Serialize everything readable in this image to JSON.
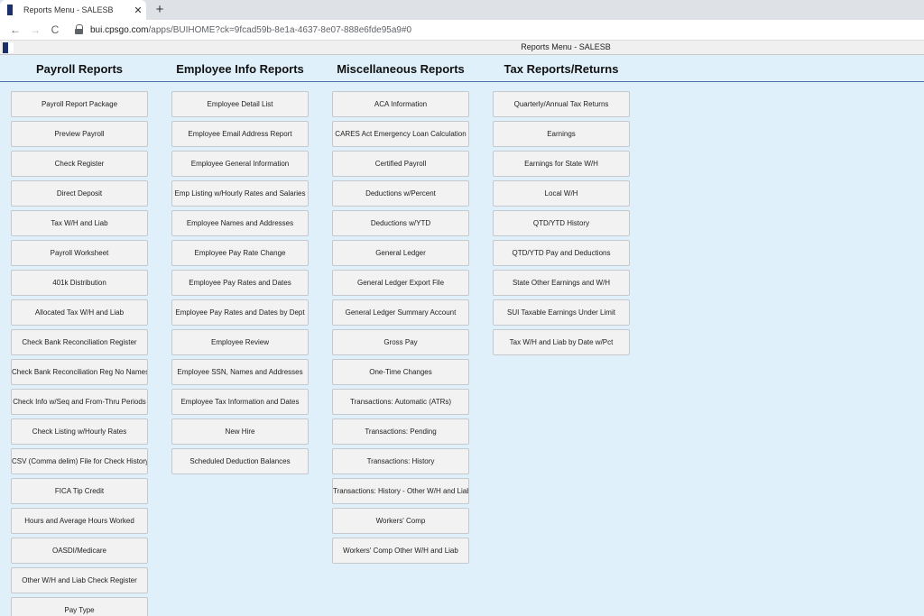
{
  "browser": {
    "tab_title": "Reports Menu - SALESB",
    "tab_close": "✕",
    "new_tab": "+",
    "url_host": "bui.cpsgo.com",
    "url_path": "/apps/BUIHOME?ck=9fcad59b-8e1a-4637-8e07-888e6fde95a9#0",
    "nav": {
      "back": "←",
      "forward": "→",
      "reload": "C"
    }
  },
  "app": {
    "title": "Reports Menu - SALESB"
  },
  "columns": [
    {
      "heading": "Payroll Reports",
      "items": [
        "Payroll Report Package",
        "Preview Payroll",
        "Check Register",
        "Direct Deposit",
        "Tax W/H and Liab",
        "Payroll Worksheet",
        "401k Distribution",
        "Allocated Tax W/H and Liab",
        "Check Bank Reconciliation Register",
        "Check Bank Reconciliation Reg No Names",
        "Check Info w/Seq and From-Thru Periods",
        "Check Listing w/Hourly Rates",
        "CSV (Comma delim) File for Check History",
        "FICA Tip Credit",
        "Hours and Average Hours Worked",
        "OASDI/Medicare",
        "Other W/H and Liab Check Register",
        "Pay Type"
      ]
    },
    {
      "heading": "Employee Info Reports",
      "items": [
        "Employee Detail List",
        "Employee Email Address Report",
        "Employee General Information",
        "Emp Listing w/Hourly Rates and Salaries",
        "Employee Names and Addresses",
        "Employee Pay Rate Change",
        "Employee Pay Rates and Dates",
        "Employee Pay Rates and Dates by Dept",
        "Employee Review",
        "Employee SSN, Names and Addresses",
        "Employee Tax Information and Dates",
        "New Hire",
        "Scheduled Deduction Balances"
      ]
    },
    {
      "heading": "Miscellaneous Reports",
      "items": [
        "ACA Information",
        "CARES Act Emergency Loan Calculation",
        "Certified Payroll",
        "Deductions w/Percent",
        "Deductions w/YTD",
        "General Ledger",
        "General Ledger Export File",
        "General Ledger Summary Account",
        "Gross Pay",
        "One-Time Changes",
        "Transactions: Automatic (ATRs)",
        "Transactions: Pending",
        "Transactions: History",
        "Transactions: History - Other W/H and Liab",
        "Workers' Comp",
        "Workers' Comp Other W/H and Liab"
      ]
    },
    {
      "heading": "Tax Reports/Returns",
      "items": [
        "Quarterly/Annual Tax Returns",
        "Earnings",
        "Earnings for State W/H",
        "Local W/H",
        "QTD/YTD History",
        "QTD/YTD Pay and Deductions",
        "State Other Earnings and W/H",
        "SUI Taxable Earnings Under Limit",
        "Tax W/H and Liab by Date w/Pct"
      ]
    }
  ]
}
